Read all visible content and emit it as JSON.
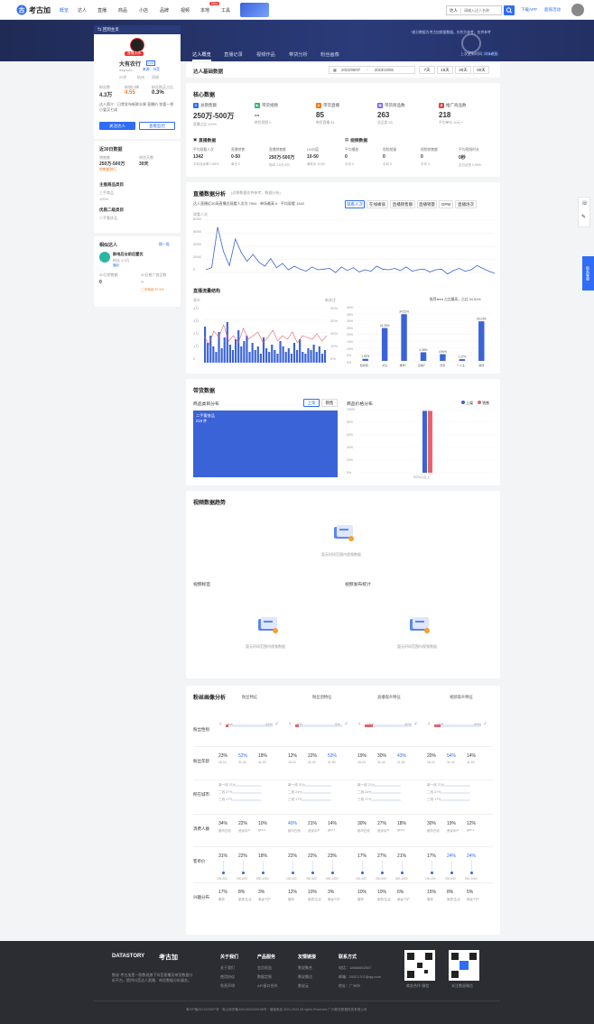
{
  "header": {
    "logo": "考古加",
    "nav": [
      "概览",
      "达人",
      "直播",
      "商品",
      "小店",
      "品牌",
      "视频",
      "本地",
      "工具"
    ],
    "new_badge": "New",
    "search_select": "达人",
    "search_placeholder": "请输入达人名称",
    "download_app": "下载APP",
    "vip": "超值活动"
  },
  "banner": {
    "notice": "*部分数据为考古加根据数据，仅作为参考，仅供参考",
    "update_time": "上次更新时间：7-16日",
    "refresh": "刷新数据",
    "tabs": [
      "达人概览",
      "直播记录",
      "视频作品",
      "带货分析",
      "粉丝画像"
    ]
  },
  "profile": {
    "back": "⇆ 回到主页",
    "live_badge": "直播大师",
    "name": "大有农行",
    "level": "LV5",
    "id": "dayouki...",
    "verify": "来源：抖音",
    "gender": "25岁",
    "region": "杭州",
    "type": "初始",
    "stats": [
      {
        "label": "粉丝数",
        "value": "4.3万"
      },
      {
        "label": "新增口碑",
        "value": "4.55"
      },
      {
        "label": "粉丝购买占比",
        "value": "0.3%"
      }
    ],
    "intro": "达人简介：日常发布新鲜水果 直播价 惊喜一把 小爱买七成",
    "btn_follow": "关注达人",
    "btn_contact": "查看监控"
  },
  "recent30": {
    "title": "近30日数据",
    "items": [
      {
        "label": "销售额",
        "value": "250万-500万"
      },
      {
        "label": "带货天数",
        "value": "30天"
      }
    ],
    "rank_label": "销售额排行",
    "cat_title": "主推商品类目",
    "cat1": "三手商品",
    "cat1_pct": "100%",
    "cat2_title": "优质二级类目",
    "cat2": "二手奢侈品"
  },
  "similar": {
    "title": "相似达人",
    "refresh": "换一批",
    "name": "群电后台前后置优",
    "fans": "粉丝 4.9万",
    "tag": "播品",
    "left_label": "30日销售额",
    "left_value": "0",
    "right_label": "30日推广商品数",
    "right_value": "--",
    "cat": "二手商品 37.5%"
  },
  "basic": {
    "title": "达人基础数据",
    "date_from": "2023/09/07",
    "date_to": "2023/10/06",
    "ranges": [
      "7天",
      "15天",
      "30天",
      "90天"
    ]
  },
  "core": {
    "title": "核心数据",
    "metrics": [
      {
        "label": "总销售额",
        "value": "250万-500万",
        "sub": "直播占比 100%"
      },
      {
        "label": "带货视频",
        "value": "--",
        "sub": "带货视频 0"
      },
      {
        "label": "带货直播",
        "value": "85",
        "sub": "带货直播 84"
      },
      {
        "label": "带货商品数",
        "value": "263",
        "sub": "总品类 53"
      },
      {
        "label": "推广商品数",
        "value": "218",
        "sub": "平均单价 10元+"
      }
    ],
    "live_title": "直播数据",
    "live": [
      {
        "label": "平均观看人次",
        "value": "1342",
        "sub": "平均互动率 0.96%"
      },
      {
        "label": "直播销售",
        "value": "0-50",
        "sub": "单日 0"
      },
      {
        "label": "直播销售额",
        "value": "250万-500万",
        "sub": "场均 2.5万-5万"
      },
      {
        "label": "UV价值",
        "value": "10-50",
        "sub": "单件价 10元+"
      }
    ],
    "video_title": "视频数据",
    "video": [
      {
        "label": "平均播放",
        "value": "0",
        "sub": "平均 0"
      },
      {
        "label": "视频销量",
        "value": "0",
        "sub": "平均 0"
      },
      {
        "label": "视频销售额",
        "value": "0",
        "sub": "平均 0"
      },
      {
        "label": "平均视频时长",
        "value": "0秒",
        "sub": "近日点赞 0.00%"
      }
    ]
  },
  "live_trend": {
    "title": "直播数据分析",
    "subtitle": "(近期数据仅供参考，数据分析)",
    "summary": "达人直播近30场直播总观看人次为 7904 · 单场最高 6 · 平均观看 1342",
    "btns": [
      "观看人次",
      "在线峰值",
      "直播销售额",
      "直播销量",
      "GPM",
      "直播场次"
    ],
    "yaxis": "观看人次",
    "yticks": [
      "8000",
      "6000",
      "4000",
      "2000",
      "0"
    ],
    "struct_title": "直播流量结构",
    "left_axis": "观众",
    "right_axis": "新关注",
    "legend_note": "推荐feed 占比最高，占比 34.51%",
    "left_yticks": [
      "4万",
      "3万",
      "2万",
      "1万",
      "0"
    ],
    "right_yticks": [
      "40%",
      "30%",
      "20%",
      "10%",
      "0%"
    ],
    "pct_yticks": [
      "40%",
      "35%",
      "30%",
      "25%",
      "20%",
      "15%",
      "10%",
      "5%",
      "0%"
    ]
  },
  "chart_data": [
    {
      "type": "line",
      "title": "直播数据分析",
      "ylabel": "观看人次",
      "ylim": [
        0,
        8000
      ],
      "values": [
        900,
        1200,
        7000,
        3500,
        1500,
        5300,
        3400,
        2100,
        3100,
        2000,
        1400,
        2500,
        1200,
        1800,
        900,
        1400,
        1000,
        700,
        1300,
        900,
        1000,
        1100,
        500,
        1300,
        800,
        1200,
        600,
        900,
        700,
        1400,
        1000,
        900,
        1100,
        800,
        1300,
        700,
        900,
        1000,
        600,
        900,
        1000,
        300,
        800,
        1100,
        700,
        900,
        1500,
        1100,
        700,
        400
      ]
    },
    {
      "type": "bar",
      "title": "直播流量结构",
      "categories": [
        "短视频引流",
        "关注",
        "推荐feed",
        "直播广场",
        "搜索",
        "个人主页",
        "其他"
      ],
      "values": [
        1.52,
        24.26,
        34.51,
        6.38,
        4.96,
        1.27,
        29.23
      ]
    },
    {
      "type": "bar",
      "title": "商品价格分布",
      "categories": [
        "500元以上"
      ],
      "series": [
        {
          "name": "上架",
          "values": [
            98
          ]
        },
        {
          "name": "销售",
          "values": [
            98
          ]
        }
      ],
      "ylim": [
        0,
        100
      ]
    }
  ],
  "goods": {
    "title": "带货数据",
    "cat_title": "商品类目分布",
    "toggle": [
      "上架",
      "销售"
    ],
    "treemap_label": "二手奢侈品",
    "treemap_count": "218 件",
    "price_title": "商品价格分布",
    "legend": [
      "上架",
      "销售"
    ],
    "yticks": [
      "100%",
      "80%",
      "60%",
      "40%",
      "20%",
      "0%"
    ],
    "xlabel": "500元以上"
  },
  "video_section": {
    "title": "视频数据趋势",
    "empty": "暂无时间范围内视频数据",
    "label_title": "视频标签",
    "publish_title": "视频发布统计"
  },
  "fans": {
    "title": "粉丝画像分析",
    "tabs": [
      "粉丝特征",
      "粉丝团特征",
      "直播观众特征",
      "视频观众特征"
    ],
    "rows": [
      {
        "label": "粉丝性别",
        "groups": [
          [
            "5%",
            "43%"
          ],
          [
            "8%",
            "9%"
          ],
          [
            "17%",
            "42%"
          ],
          [
            "13%",
            "49%"
          ]
        ]
      },
      {
        "label": "粉丝年龄",
        "groups": [
          [
            "23%",
            "52%",
            "18%"
          ],
          [
            "12%",
            "22%",
            "53%"
          ],
          [
            "19%",
            "30%",
            "43%"
          ],
          [
            "20%",
            "54%",
            "14%"
          ]
        ],
        "ages": [
          "18-24",
          "31-40",
          "41-50"
        ]
      },
      {
        "label": "所在城市",
        "groups": [
          [
            "新一线 21%",
            "二线 27%",
            "三线 17%"
          ],
          [
            "新一线 31%",
            "二线 24%",
            "三线 17%"
          ],
          [
            "新一线 21%",
            "二线 24%",
            "三线 17%"
          ],
          [
            "新一线 21%",
            "二线 27%",
            "三线 17%"
          ]
        ]
      },
      {
        "label": "消费人群",
        "groups": [
          [
            "34%",
            "22%",
            "10%"
          ],
          [
            "40%",
            "21%",
            "14%"
          ],
          [
            "30%",
            "27%",
            "18%"
          ],
          [
            "30%",
            "19%",
            "12%"
          ]
        ],
        "names": [
          "都市白领",
          "资深中产",
          "gen z"
        ]
      },
      {
        "label": "客单价",
        "groups": [
          [
            "31%",
            "22%",
            "18%"
          ],
          [
            "22%",
            "22%",
            "23%"
          ],
          [
            "17%",
            "27%",
            "21%"
          ],
          [
            "17%",
            "24%",
            "24%"
          ]
        ],
        "ranges": [
          "100-200",
          "200-500",
          "500-1000"
        ]
      },
      {
        "label": "兴趣分布",
        "groups": [
          [
            "17%",
            "8%",
            "3%"
          ],
          [
            "12%",
            "10%",
            "3%"
          ],
          [
            "10%",
            "10%",
            "6%"
          ],
          [
            "15%",
            "8%",
            "5%"
          ]
        ],
        "names": [
          "服饰",
          "家居/生活",
          "美妆个护"
        ]
      }
    ]
  },
  "footer": {
    "brand1": "DATASTORY",
    "brand2": "考古加",
    "desc": "数说·考古加是一款数说旗下抖音直播及带货数据分析平台，提供抖音达人直播、带货数据分析服务。",
    "cols": [
      {
        "title": "关于我们",
        "links": [
          "关于我们",
          "使用协议",
          "免责声明"
        ]
      },
      {
        "title": "产品服务",
        "links": [
          "会员权益",
          "数据定制",
          "API接口合作"
        ]
      },
      {
        "title": "友情链接",
        "links": [
          "数说聚合",
          "数说雷达",
          "数说云"
        ]
      },
      {
        "title": "联系方式",
        "links": [
          "电话：18666652507",
          "邮箱：25571707@qq.com",
          "地址：广州市"
        ]
      }
    ],
    "qr1": "商务合作·微信",
    "qr2": "关注数说微信",
    "copyright": "粤ICP备2021023597号 · 粤公网安备44010602009156号 · 增值电信 2021-2023 All rights Reserved 广州数说数据科技有限公司"
  },
  "sidebtns": {
    "service": "联系客服",
    "feedback": "意见反馈"
  }
}
